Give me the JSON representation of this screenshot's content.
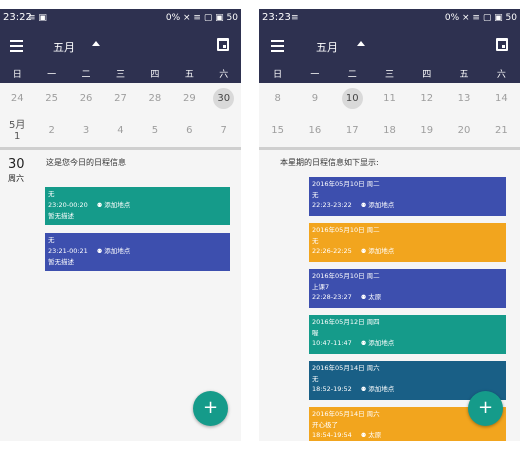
{
  "left": {
    "status": {
      "time": "23:22",
      "icons": "≡ ▣",
      "right": "0% × ≡ ▢ ▣ 50"
    },
    "month": "五月",
    "weekdays": [
      "日",
      "一",
      "二",
      "三",
      "四",
      "五",
      "六"
    ],
    "rows": [
      [
        {
          "d": "24"
        },
        {
          "d": "25"
        },
        {
          "d": "26"
        },
        {
          "d": "27"
        },
        {
          "d": "28"
        },
        {
          "d": "29"
        },
        {
          "d": "30",
          "sel": true
        }
      ],
      [
        {
          "d": "5月",
          "sub": "1"
        },
        {
          "d": "2"
        },
        {
          "d": "3"
        },
        {
          "d": "4"
        },
        {
          "d": "5"
        },
        {
          "d": "6"
        },
        {
          "d": "7"
        }
      ]
    ],
    "day_num": "30",
    "day_week": "周六",
    "info": "这是您今日的日程信息",
    "events": [
      {
        "line1": "无",
        "time": "23:20-00:20",
        "loc": "添加地点",
        "desc": "暂无描述",
        "color": "#159b8a"
      },
      {
        "line1": "无",
        "time": "23:21-00:21",
        "loc": "添加地点",
        "desc": "暂无描述",
        "color": "#3d4fae"
      }
    ],
    "fab": "+"
  },
  "right": {
    "status": {
      "time": "23:23",
      "icons": "≡",
      "right": "0% × ≡ ▢ ▣ 50"
    },
    "month": "五月",
    "weekdays": [
      "日",
      "一",
      "二",
      "三",
      "四",
      "五",
      "六"
    ],
    "rows": [
      [
        {
          "d": "8"
        },
        {
          "d": "9"
        },
        {
          "d": "10",
          "sel": true
        },
        {
          "d": "11"
        },
        {
          "d": "12"
        },
        {
          "d": "13"
        },
        {
          "d": "14"
        }
      ],
      [
        {
          "d": "15"
        },
        {
          "d": "16"
        },
        {
          "d": "17"
        },
        {
          "d": "18"
        },
        {
          "d": "19"
        },
        {
          "d": "20"
        },
        {
          "d": "21"
        }
      ]
    ],
    "info": "本星期的日程信息如下显示:",
    "events": [
      {
        "date": "2016年05月10日  周二",
        "line1": "无",
        "time": "22:23-23:22",
        "loc": "添加地点",
        "color": "#3d4fae"
      },
      {
        "date": "2016年05月10日  周二",
        "line1": "无",
        "time": "22:26-22:25",
        "loc": "添加地点",
        "color": "#f2a51e"
      },
      {
        "date": "2016年05月10日  周二",
        "line1": "上课7",
        "time": "22:28-23:27",
        "loc": "太原",
        "color": "#3d4fae"
      },
      {
        "date": "2016年05月12日  周四",
        "line1": "喔",
        "time": "10:47-11:47",
        "loc": "添加地点",
        "color": "#159b8a"
      },
      {
        "date": "2016年05月14日  周六",
        "line1": "无",
        "time": "18:52-19:52",
        "loc": "添加地点",
        "color": "#195f86"
      },
      {
        "date": "2016年05月14日  周六",
        "line1": "开心极了",
        "time": "18:54-19:54",
        "loc": "太原",
        "color": "#f2a51e"
      }
    ],
    "fab": "+"
  }
}
